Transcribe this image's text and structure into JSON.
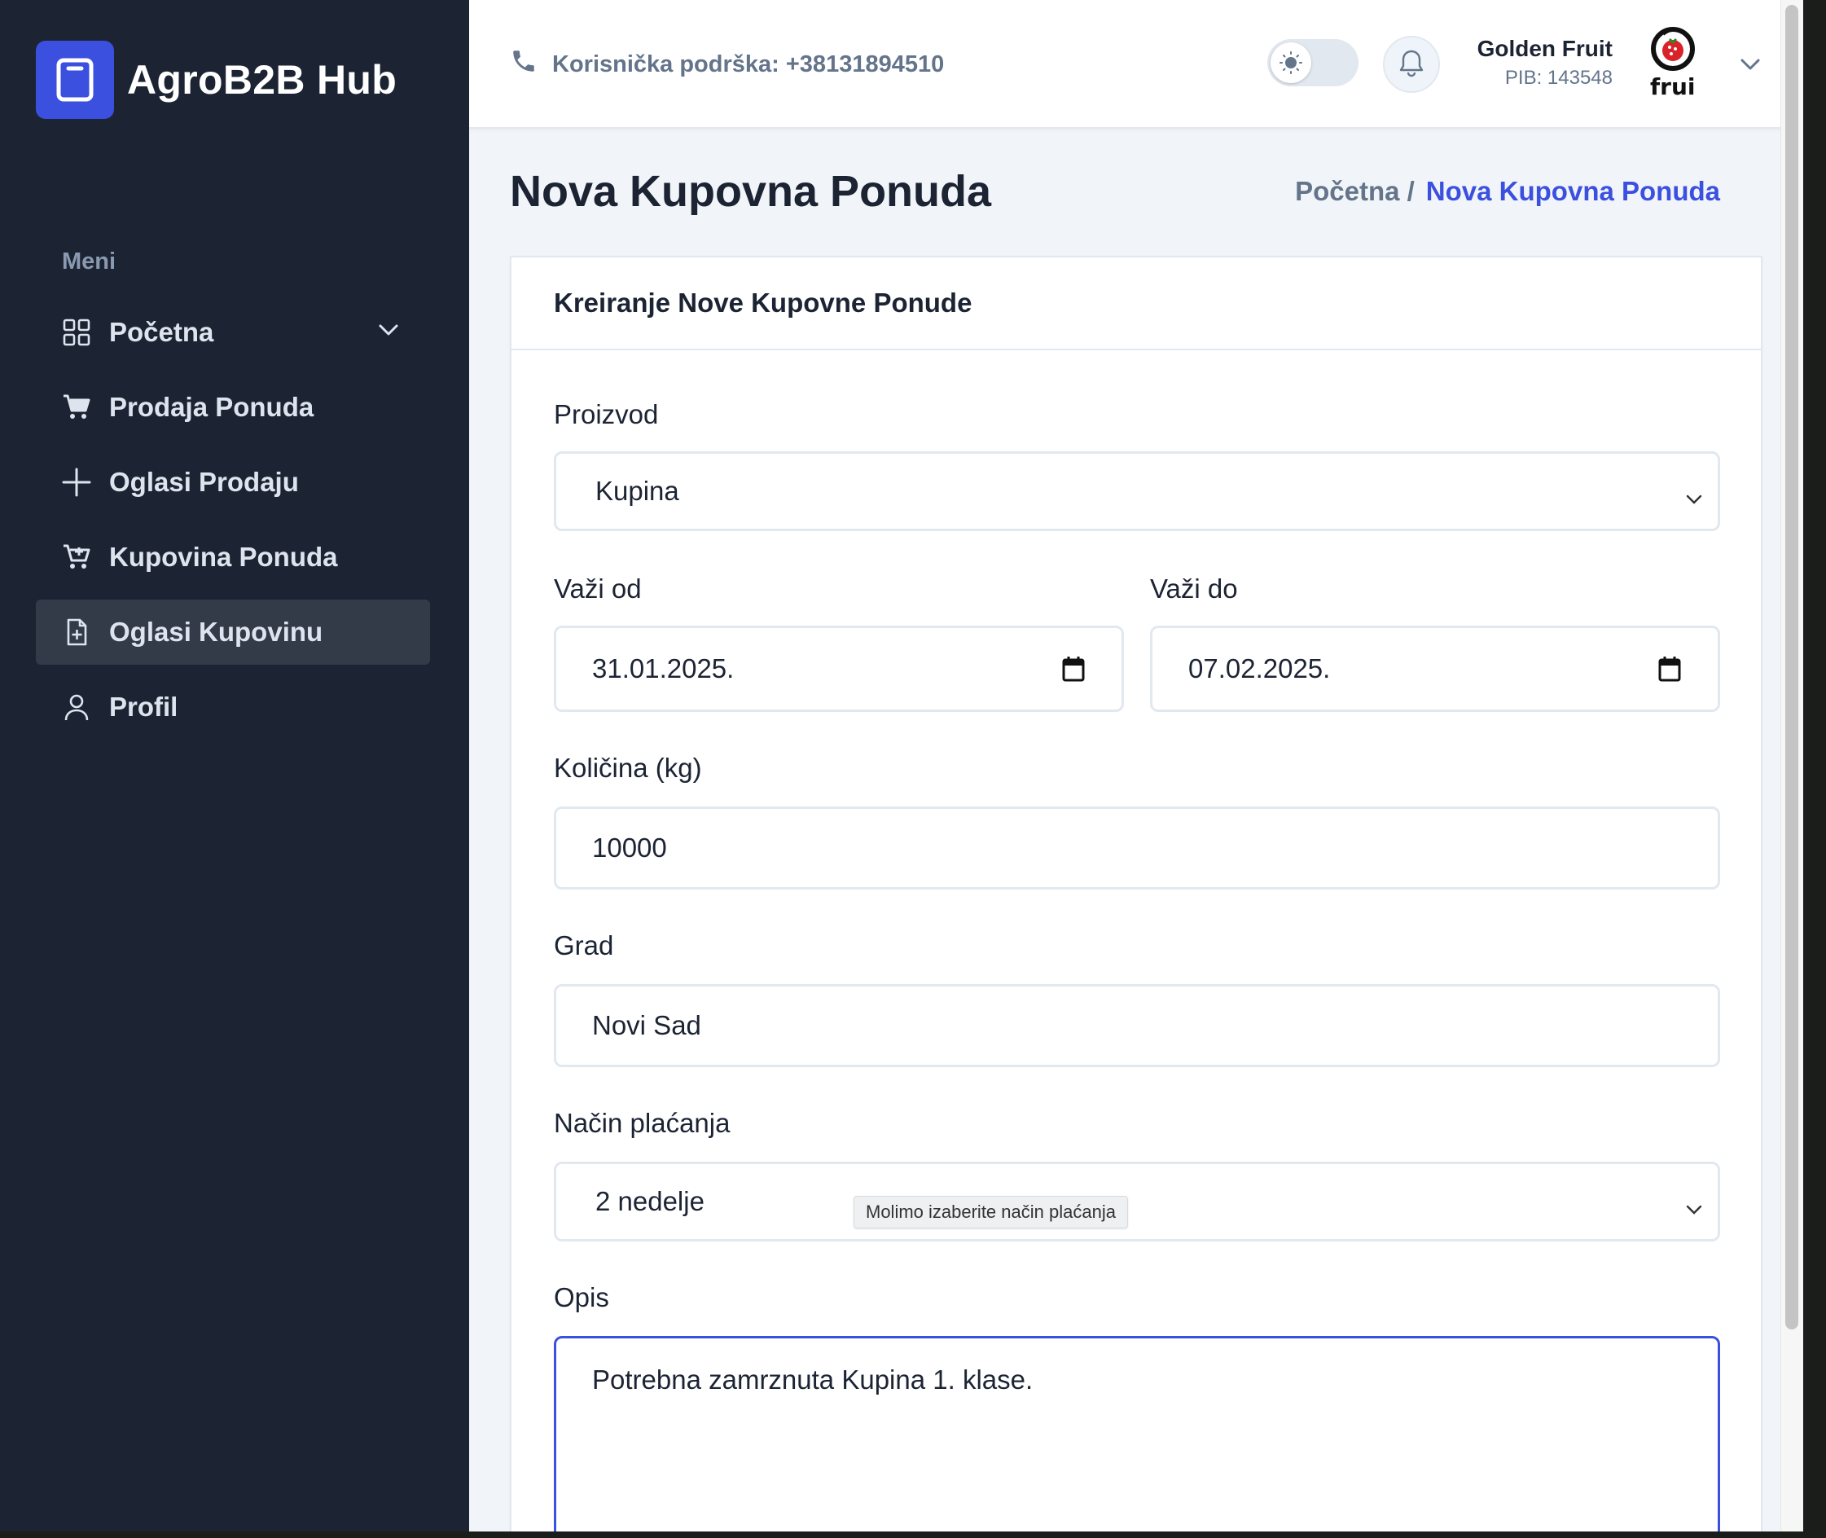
{
  "brand": {
    "name": "AgroB2B Hub",
    "logo_icon": "tablet-icon",
    "accent": "#3C50E0"
  },
  "sidebar": {
    "heading": "Meni",
    "items": [
      {
        "label": "Početna",
        "icon": "grid-icon",
        "has_chevron": true,
        "active": false
      },
      {
        "label": "Prodaja Ponuda",
        "icon": "cart-icon",
        "active": false
      },
      {
        "label": "Oglasi Prodaju",
        "icon": "plus-icon",
        "active": false
      },
      {
        "label": "Kupovina Ponuda",
        "icon": "cart-plus-icon",
        "active": false
      },
      {
        "label": "Oglasi Kupovinu",
        "icon": "file-plus-icon",
        "active": true
      },
      {
        "label": "Profil",
        "icon": "user-icon",
        "active": false
      }
    ]
  },
  "header": {
    "support_text": "Korisnička podrška: +38131894510",
    "user": {
      "name": "Golden Fruit",
      "pib": "PIB: 143548"
    },
    "avatar_text": "frui"
  },
  "page": {
    "title": "Nova Kupovna Ponuda",
    "breadcrumb": {
      "home": "Početna /",
      "current": "Nova Kupovna Ponuda"
    }
  },
  "form": {
    "title": "Kreiranje Nove Kupovne Ponude",
    "product": {
      "label": "Proizvod",
      "value": "Kupina"
    },
    "valid_from": {
      "label": "Važi od",
      "value": "31.01.2025."
    },
    "valid_to": {
      "label": "Važi do",
      "value": "07.02.2025."
    },
    "quantity": {
      "label": "Količina (kg)",
      "value": "10000"
    },
    "city": {
      "label": "Grad",
      "value": "Novi Sad"
    },
    "payment": {
      "label": "Način plaćanja",
      "value": "2 nedelje",
      "tooltip": "Molimo izaberite način plaćanja"
    },
    "description": {
      "label": "Opis",
      "value": "Potrebna zamrznuta Kupina 1. klase."
    }
  }
}
